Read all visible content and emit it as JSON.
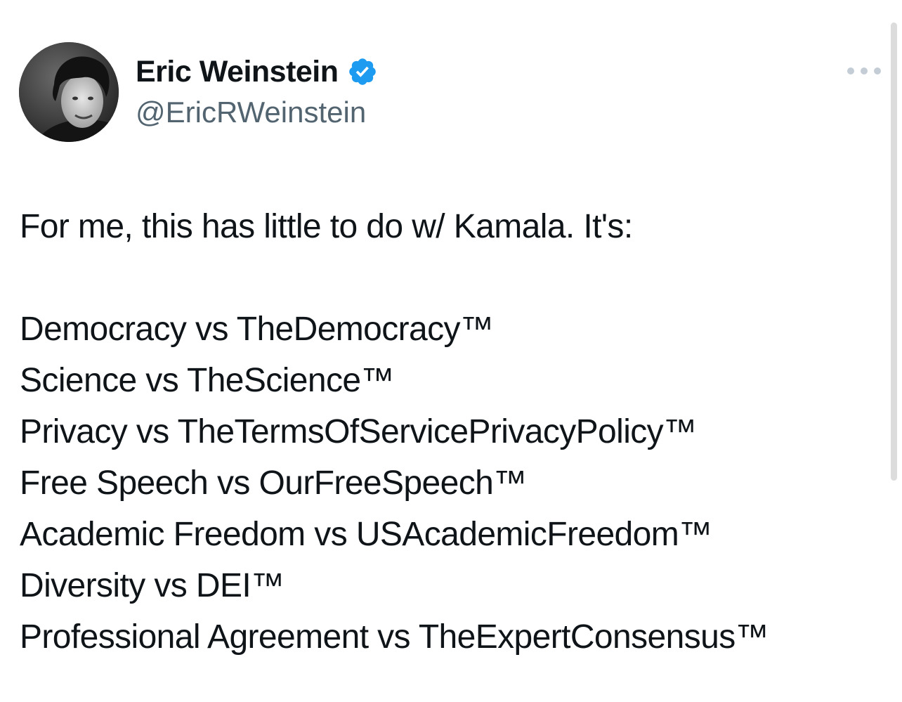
{
  "author": {
    "name": "Eric Weinstein",
    "handle": "@EricRWeinstein",
    "verified_icon": "verified-badge-icon",
    "verified_color": "#1d9bf0"
  },
  "menu": {
    "icon": "more-options-icon"
  },
  "tweet": {
    "intro": "For me, this has little to do w/ Kamala. It's:",
    "lines": [
      "Democracy vs TheDemocracy™",
      "Science vs TheScience™",
      "Privacy vs TheTermsOfServicePrivacyPolicy™",
      "Free Speech vs OurFreeSpeech™",
      "Academic Freedom vs USAcademicFreedom™",
      "Diversity vs DEI™",
      "Professional Agreement vs TheExpertConsensus™"
    ]
  },
  "colors": {
    "text": "#0f1419",
    "secondary_text": "#536471",
    "background": "#ffffff"
  }
}
